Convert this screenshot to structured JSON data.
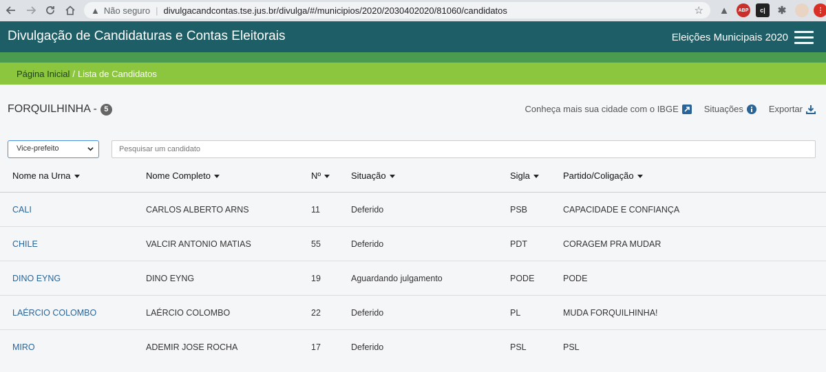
{
  "browser": {
    "not_secure": "Não seguro",
    "url": "divulgacandcontas.tse.jus.br/divulga/#/municipios/2020/2030402020/81060/candidatos"
  },
  "header": {
    "title": "Divulgação de Candidaturas e Contas Eleitorais",
    "election": "Eleições Municipais 2020"
  },
  "breadcrumb": {
    "home": "Página Inicial",
    "separator": "/",
    "current": "Lista de Candidatos"
  },
  "city": {
    "name": "FORQUILHINHA -",
    "count": "5"
  },
  "tools": {
    "ibge": "Conheça mais sua cidade com o IBGE",
    "situacoes": "Situações",
    "exportar": "Exportar"
  },
  "filter": {
    "role": "Vice-prefeito",
    "search_placeholder": "Pesquisar um candidato"
  },
  "table": {
    "headers": [
      "Nome na Urna",
      "Nome Completo",
      "Nº",
      "Situação",
      "Sigla",
      "Partido/Coligação"
    ],
    "rows": [
      [
        "CALI",
        "CARLOS ALBERTO ARNS",
        "11",
        "Deferido",
        "PSB",
        "CAPACIDADE E CONFIANÇA"
      ],
      [
        "CHILE",
        "VALCIR ANTONIO MATIAS",
        "55",
        "Deferido",
        "PDT",
        "CORAGEM PRA MUDAR"
      ],
      [
        "DINO EYNG",
        "DINO EYNG",
        "19",
        "Aguardando julgamento",
        "PODE",
        "PODE"
      ],
      [
        "LAÉRCIO COLOMBO",
        "LAÉRCIO COLOMBO",
        "22",
        "Deferido",
        "PL",
        "MUDA FORQUILHINHA!"
      ],
      [
        "MIRO",
        "ADEMIR JOSE ROCHA",
        "17",
        "Deferido",
        "PSL",
        "PSL"
      ]
    ]
  },
  "colors": {
    "header_bg": "#1e5f67",
    "band_green": "#4a9a4f",
    "breadcrumb_bg": "#8cc63f",
    "link": "#2a6496"
  }
}
